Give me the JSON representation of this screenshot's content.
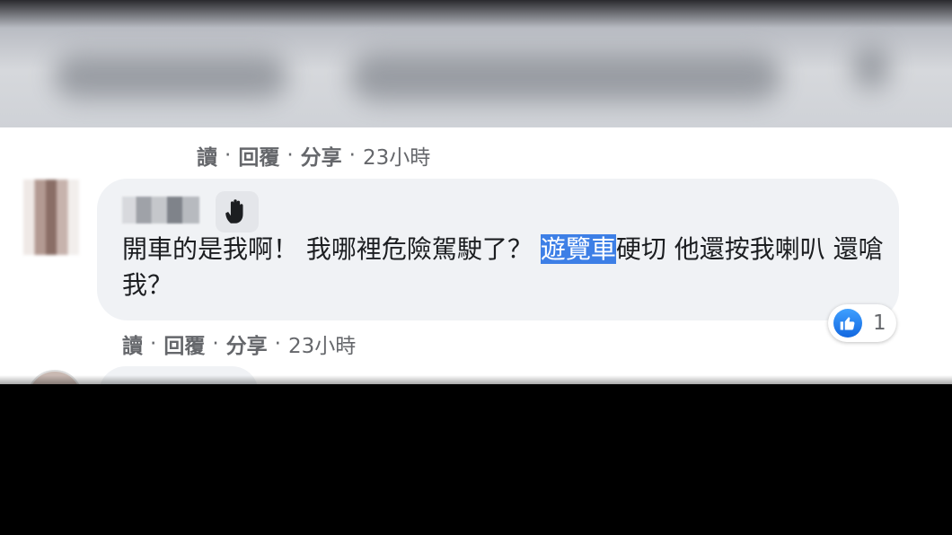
{
  "previous_comment": {
    "actions": [
      "讀",
      "回覆",
      "分享"
    ],
    "separator": "·",
    "time": "23小時"
  },
  "comment": {
    "author_badge_icon": "waving-hand-icon",
    "text_before": "開車的是我啊！ 我哪裡危險駕駛了？ ",
    "text_highlighted": "遊覽車",
    "text_after": "硬切 他還按我喇叭 還嗆我？",
    "actions": [
      "讀",
      "回覆",
      "分享"
    ],
    "separator": "·",
    "time": "23小時",
    "reaction": {
      "icon": "like-icon",
      "count": "1",
      "color": "#1877f2"
    }
  },
  "colors": {
    "highlight": "#3d7fe6",
    "bubble": "#f0f2f5",
    "meta_text": "#65676b"
  }
}
